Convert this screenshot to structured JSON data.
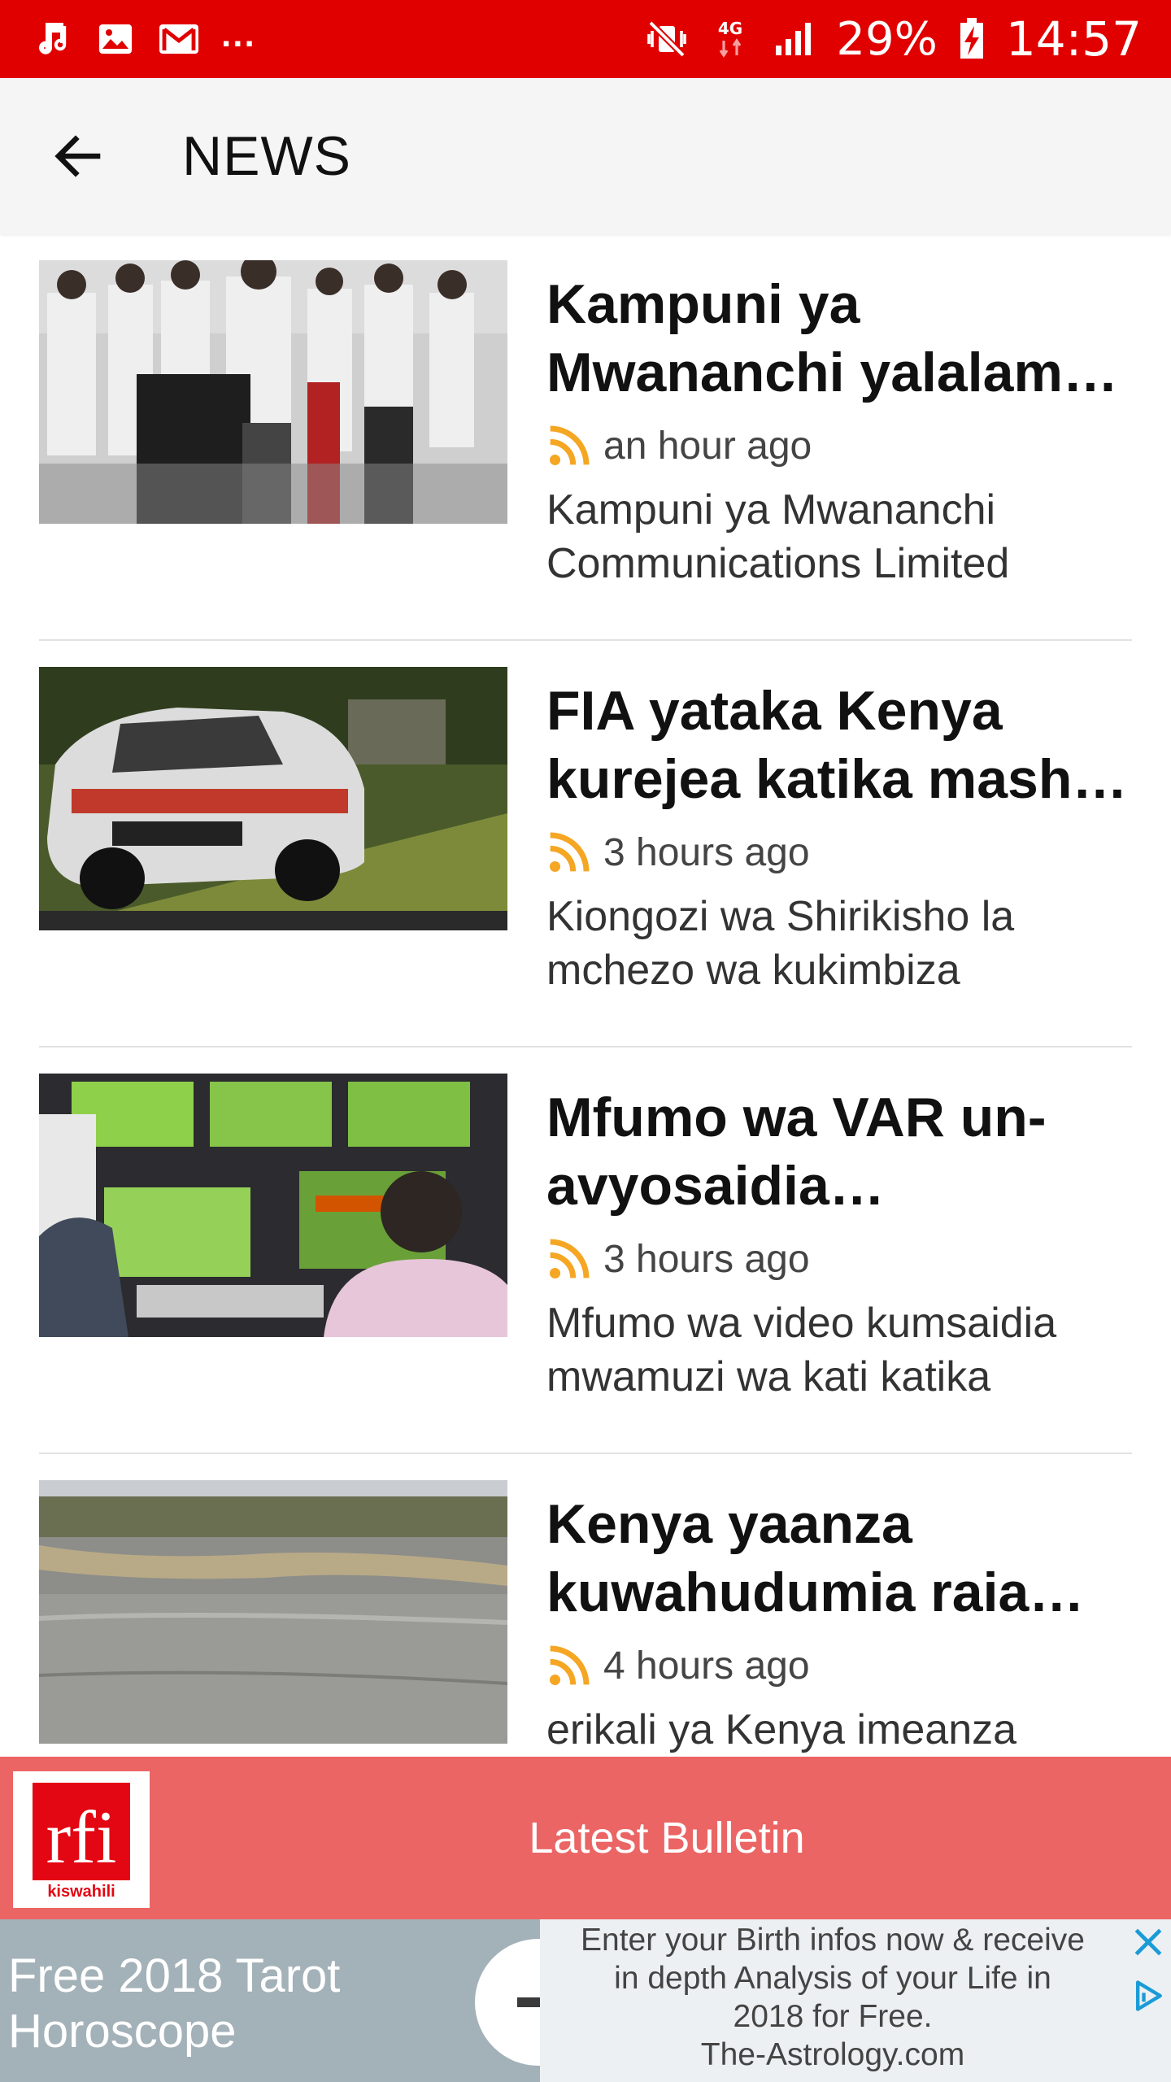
{
  "status_bar": {
    "more": "...",
    "network": "4G",
    "battery": "29%",
    "time": "14:57"
  },
  "app_bar": {
    "title": "NEWS"
  },
  "news": [
    {
      "headline": "Kampuni ya Mwananchi yalalam…",
      "time": "an hour ago",
      "summary": "Kampuni ya Mwananchi Communications Limited"
    },
    {
      "headline": "FIA yataka Kenya kurejea katika mash…",
      "time": "3 hours ago",
      "summary": "Kiongozi wa Shirikisho la mchezo wa kukimbiza"
    },
    {
      "headline": "Mfumo wa VAR un-avyosaidia maamuzi…",
      "time": "3 hours ago",
      "summary": "Mfumo wa video kumsaidia mwamuzi wa kati katika"
    },
    {
      "headline": "Kenya yaanza kuwahudumia raia w…",
      "time": "4 hours ago",
      "summary": "erikali ya Kenya imeanza"
    }
  ],
  "bulletin": {
    "label": "Latest Bulletin",
    "logo_text": "rfi",
    "logo_sub": "kiswahili"
  },
  "ad": {
    "left_text": "Free 2018 Tarot Horoscope",
    "right_lines": [
      "Enter your Birth infos now & receive",
      "in depth Analysis of your Life in",
      "2018 for Free.",
      "The-Astrology.com"
    ]
  },
  "colors": {
    "status_bar": "#e00000",
    "bulletin_bar": "#eb6565",
    "rss": "#f5a623",
    "ad_bg": "#a3b1b8",
    "ad_accent": "#1a9bd7"
  }
}
